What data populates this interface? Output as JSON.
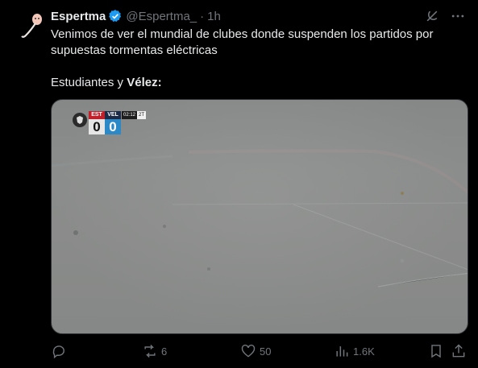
{
  "author": {
    "name": "Espertma",
    "handle": "@Espertma_",
    "separator": "·",
    "time": "1h"
  },
  "post": {
    "line1": "Venimos de ver el mundial de clubes donde suspenden los partidos por supuestas tormentas eléctricas",
    "line2_prefix": "Estudiantes y ",
    "line2_bold": "Vélez:"
  },
  "scoreboard": {
    "home": "EST",
    "away": "VEL",
    "home_score": "0",
    "away_score": "0",
    "clock": "02:12",
    "period": "2T"
  },
  "actions": {
    "reply_count": "",
    "retweet_count": "6",
    "like_count": "50",
    "views_count": "1.6K"
  },
  "colors": {
    "background": "#000000",
    "text": "#e7e9ea",
    "muted": "#71767b",
    "verified": "#1d9bf0"
  }
}
